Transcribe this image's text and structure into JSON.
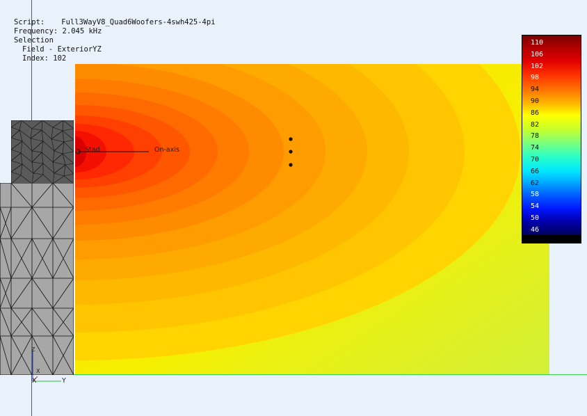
{
  "info": {
    "script_key": "Script:",
    "script_val": "Full3WayV8_Quad6Woofers-4swh425-4pi",
    "frequency_key": "Frequency:",
    "frequency_val": "2.045 kHz",
    "selection": "Selection",
    "field": "Field - ExteriorYZ",
    "index": "Index: 102"
  },
  "labels": {
    "start": "Stad",
    "on_axis": "On-axis",
    "axis_z": "Z",
    "axis_x": "X",
    "axis_y": "Y"
  },
  "colorbar": {
    "ticks": [
      "110",
      "106",
      "102",
      "98",
      "94",
      "90",
      "86",
      "82",
      "78",
      "74",
      "70",
      "66",
      "62",
      "58",
      "54",
      "50",
      "46"
    ],
    "top_color": "#7a0000",
    "bottom_color": "#000060"
  }
}
